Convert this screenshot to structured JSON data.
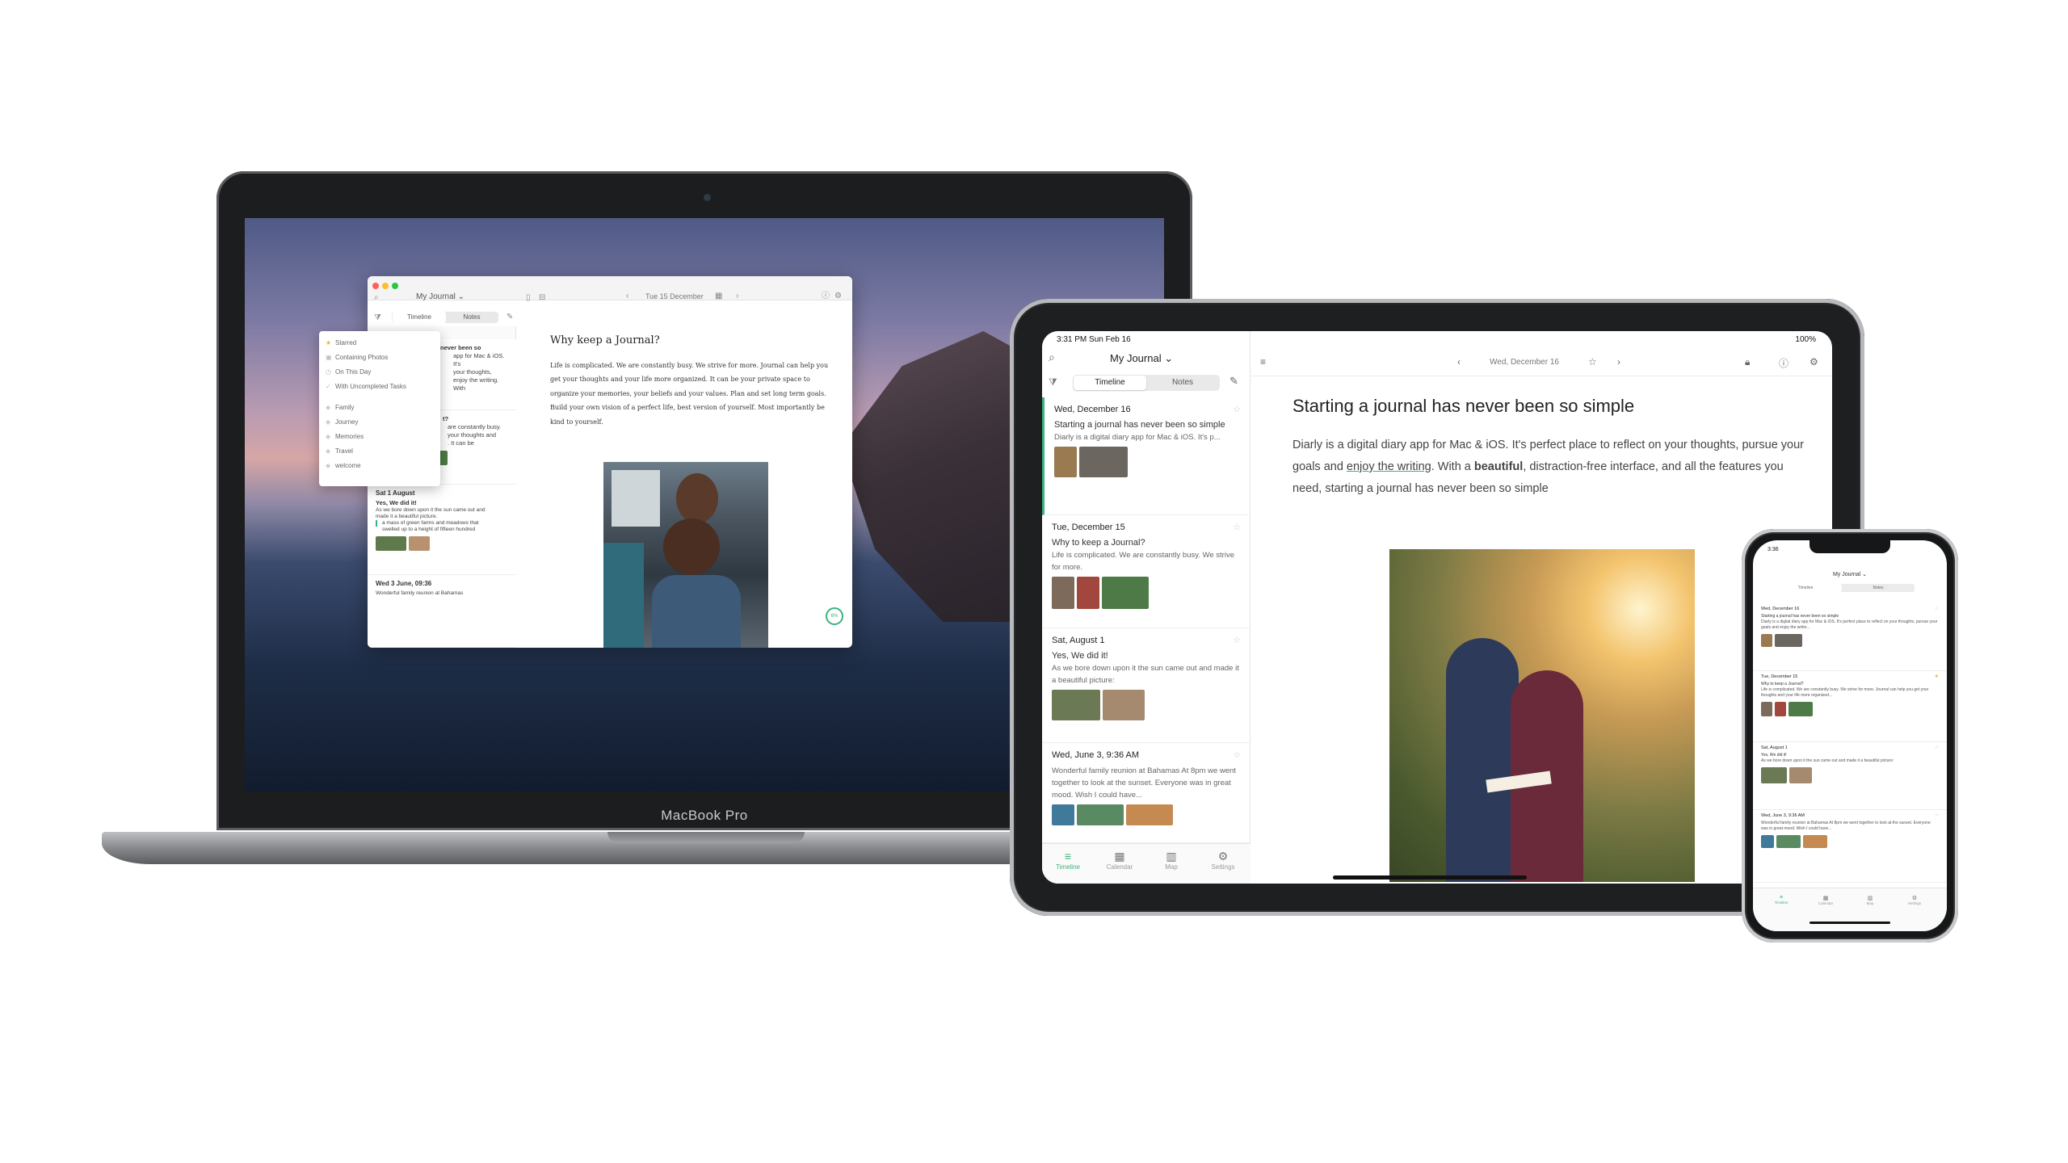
{
  "colors": {
    "accent": "#3bb37e",
    "star": "#e8b23c"
  },
  "macbook": {
    "brand": "MacBook Pro",
    "app": {
      "journal_selector": "My Journal ⌄",
      "date_nav": "Tue 15 December",
      "tabs": [
        "Timeline",
        "Notes"
      ],
      "filter_menu": {
        "smart_filters": [
          "Starred",
          "Containing Photos",
          "On This Day",
          "With Uncompleted Tasks"
        ],
        "tags": [
          "Family",
          "Journey",
          "Memories",
          "Travel",
          "welcome"
        ]
      },
      "entries": [
        {
          "title": "never been so",
          "lines": [
            "app for Mac & iOS. It's",
            "your thoughts,",
            "enjoy the writing. With"
          ]
        },
        {
          "title": "t?",
          "lines": [
            "are constantly busy.",
            "your thoughts and",
            ". It can be"
          ]
        },
        {
          "date": "Sat 1 August",
          "title": "Yes, We did it!",
          "lines": [
            "As we bore down upon it the sun came out and",
            "made it a beautiful picture.",
            "a mass of green farms and meadows that",
            "swelled up to a height of fifteen hundred"
          ]
        },
        {
          "date": "Wed 3 June,  09:36",
          "lines": [
            "Wonderful family reunion at Bahamas"
          ]
        }
      ],
      "article_title": "Why keep a Journal?",
      "article_body": "Life is complicated. We are constantly busy.  We strive for more. Journal can help you get your thoughts and your life more organized.  It can be your private space to organize your memories, your beliefs and your values. Plan and set long term goals.  Build your own vision of a perfect life, best version of yourself. Most importantly be kind to yourself.",
      "progress_label": "6%"
    }
  },
  "ipad": {
    "status_time": "3:31 PM  Sun Feb 16",
    "status_right": "100%",
    "journal_selector": "My Journal ⌄",
    "tabs": [
      "Timeline",
      "Notes"
    ],
    "entries": [
      {
        "date": "Wed, December 16",
        "title": "Starting a journal has never been so simple",
        "excerpt": "Diarly is a digital diary app for Mac & iOS. It's p..."
      },
      {
        "date": "Tue, December 15",
        "title": "Why to keep a Journal?",
        "excerpt": "Life is complicated. We are constantly busy.  We strive for more."
      },
      {
        "date": "Sat, August 1",
        "title": "Yes, We did it!",
        "excerpt": "As we bore down upon it the sun came out and made it a beautiful picture:"
      },
      {
        "date": "Wed, June 3,  9:36 AM",
        "title": "",
        "excerpt": "Wonderful family reunion at Bahamas At 8pm we went together to look at the sunset. Everyone was in great mood. Wish I could have..."
      }
    ],
    "tabbar": [
      "Timeline",
      "Calendar",
      "Map",
      "Settings"
    ],
    "toolbar_date": "Wed, December 16",
    "heading": "Starting a journal has never been so simple",
    "paragraph": {
      "p1": "Diarly is a digital diary app for Mac & iOS. It's perfect place to reflect on your thoughts, pursue your goals and ",
      "link": "enjoy the writing",
      "p2": ". With a ",
      "bold": "beautiful",
      "p3": ", distraction-free interface, and all the features you need, starting a journal has never been so simple"
    }
  },
  "iphone": {
    "status_time": "3:36",
    "journal_selector": "My Journal ⌄",
    "tabs": [
      "Timeline",
      "Notes"
    ],
    "entries": [
      {
        "date": "Wed, December 16",
        "title": "Starting a journal has never been so simple",
        "excerpt": "Diarly is a digital diary app for Mac & iOS. It's perfect place to reflect on your thoughts, pursue your goals and enjoy the writin..."
      },
      {
        "date": "Tue, December 15",
        "title": "Why to keep a Journal?",
        "excerpt": "Life is complicated. We are constantly busy.  We strive for more. Journal can help you get your thoughts and your life more organized..."
      },
      {
        "date": "Sat, August 1",
        "title": "Yes, We did it!",
        "excerpt": "As we bore down upon it the sun came out and made it a beautiful picture:"
      },
      {
        "date": "Wed, June 3,  9:36 AM",
        "title": "",
        "excerpt": "Wonderful family reunion at Bahamas At 8pm we went together to look at the sunset. Everyone was in great mood. Wish I could have..."
      }
    ],
    "tabbar": [
      "Timeline",
      "Calendar",
      "Map",
      "Settings"
    ]
  }
}
